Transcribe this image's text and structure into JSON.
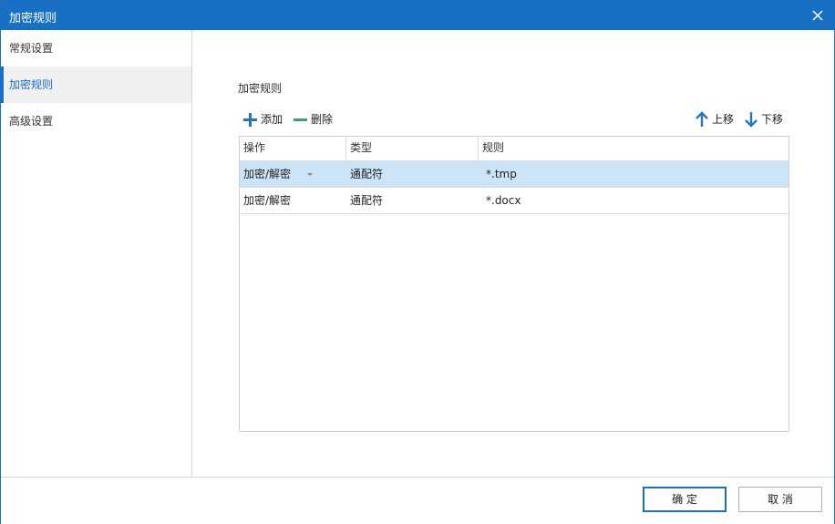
{
  "window": {
    "title": "加密规则"
  },
  "sidebar": {
    "items": [
      {
        "label": "常规设置",
        "active": false
      },
      {
        "label": "加密规则",
        "active": true
      },
      {
        "label": "高级设置",
        "active": false
      }
    ]
  },
  "main": {
    "section_title": "加密规则",
    "toolbar": {
      "add_label": "添加",
      "delete_label": "删除",
      "move_up_label": "上移",
      "move_down_label": "下移"
    },
    "table": {
      "columns": [
        "操作",
        "类型",
        "规则"
      ],
      "rows": [
        {
          "operation": "加密/解密",
          "type": "通配符",
          "rule": "*.tmp",
          "selected": true
        },
        {
          "operation": "加密/解密",
          "type": "通配符",
          "rule": "*.docx",
          "selected": false
        }
      ]
    }
  },
  "footer": {
    "ok_label": "确 定",
    "cancel_label": "取 消"
  },
  "colors": {
    "titlebar": "#1770c4",
    "accent": "#1c6fbf",
    "selected_row": "#cce4f7",
    "add_icon": "#2b73b8",
    "delete_icon": "#3f9e79"
  },
  "icons": {
    "close": "close-icon",
    "add": "plus-icon",
    "delete": "minus-icon",
    "move_up": "arrow-up-icon",
    "move_down": "arrow-down-icon",
    "dropdown": "chevron-down-icon"
  }
}
